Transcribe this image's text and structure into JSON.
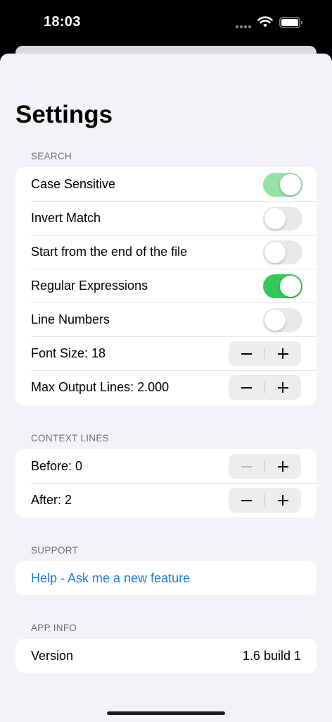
{
  "status_bar": {
    "time": "18:03",
    "icons": [
      "cellular-dots-icon",
      "wifi-icon",
      "battery-icon"
    ]
  },
  "page": {
    "title": "Settings"
  },
  "sections": {
    "search": {
      "header": "SEARCH",
      "rows": [
        {
          "label": "Case Sensitive",
          "control": "toggle",
          "on": true
        },
        {
          "label": "Invert Match",
          "control": "toggle",
          "on": false
        },
        {
          "label": "Start from the end of the file",
          "control": "toggle",
          "on": false
        },
        {
          "label": "Regular Expressions",
          "control": "toggle",
          "on": true
        },
        {
          "label": "Line Numbers",
          "control": "toggle",
          "on": false
        },
        {
          "label": "Font Size: 18",
          "control": "stepper"
        },
        {
          "label": "Max Output Lines: 2.000",
          "control": "stepper"
        }
      ]
    },
    "context": {
      "header": "CONTEXT LINES",
      "rows": [
        {
          "label": "Before: 0",
          "control": "stepper",
          "minus_disabled": true
        },
        {
          "label": "After: 2",
          "control": "stepper"
        }
      ]
    },
    "support": {
      "header": "SUPPORT",
      "link_label": "Help - Ask me a new feature"
    },
    "app_info": {
      "header": "APP INFO",
      "version_label": "Version",
      "version_value": "1.6 build 1"
    }
  },
  "colors": {
    "accent": "#1a7ee8",
    "toggle_on": "#34c759",
    "background": "#f2f2f7"
  }
}
